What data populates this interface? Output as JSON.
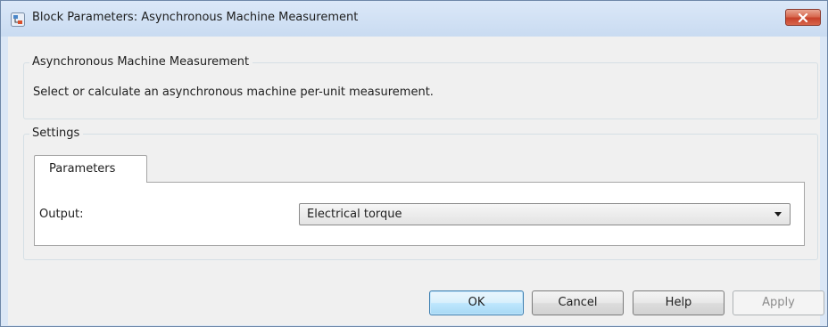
{
  "window": {
    "title": "Block Parameters: Asynchronous Machine Measurement",
    "app_icon": "simulink-block-icon",
    "close_icon": "close-icon",
    "close_color": "#c7412a"
  },
  "block": {
    "name": "Asynchronous Machine Measurement",
    "description": "Select or calculate an asynchronous machine per-unit measurement."
  },
  "settings": {
    "label": "Settings",
    "tabs": [
      {
        "label": "Parameters",
        "selected": true
      }
    ],
    "parameters": {
      "output_label": "Output:",
      "output_value": "Electrical torque"
    }
  },
  "buttons": {
    "ok": "OK",
    "cancel": "Cancel",
    "help": "Help",
    "apply": "Apply"
  },
  "colors": {
    "default_button_border": "#3c7fb1",
    "dialog_background": "#f0f0f0"
  }
}
